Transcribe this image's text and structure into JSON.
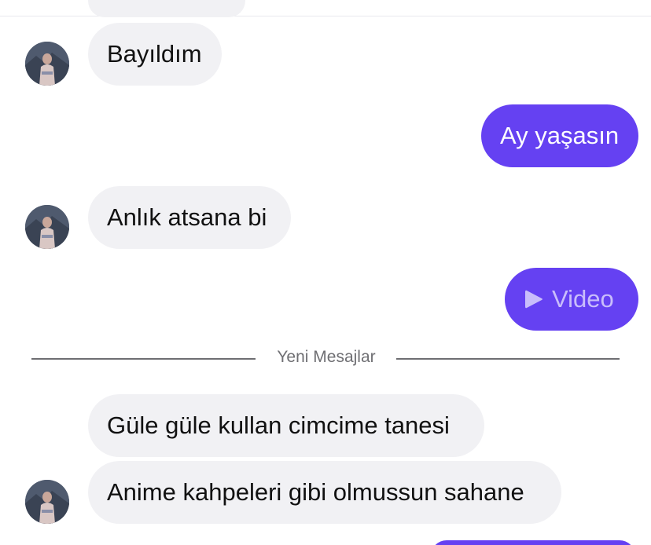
{
  "colors": {
    "incoming_bubble": "#f1f1f4",
    "outgoing_bubble": "#6541f2",
    "video_label": "#c9bdfb",
    "divider_text": "#6f6f73"
  },
  "messages": [
    {
      "direction": "incoming",
      "text": "Bayıldım"
    },
    {
      "direction": "outgoing",
      "text": "Ay yaşasın"
    },
    {
      "direction": "incoming",
      "text": "Anlık atsana bi"
    },
    {
      "direction": "outgoing",
      "type": "video",
      "icon": "play-icon",
      "text": "Video"
    },
    {
      "direction": "incoming",
      "text": "Güle güle kullan cimcime tanesi"
    },
    {
      "direction": "incoming",
      "text": "Anime kahpeleri gibi olmussun sahane"
    }
  ],
  "new_messages_divider": "Yeni Mesajlar"
}
